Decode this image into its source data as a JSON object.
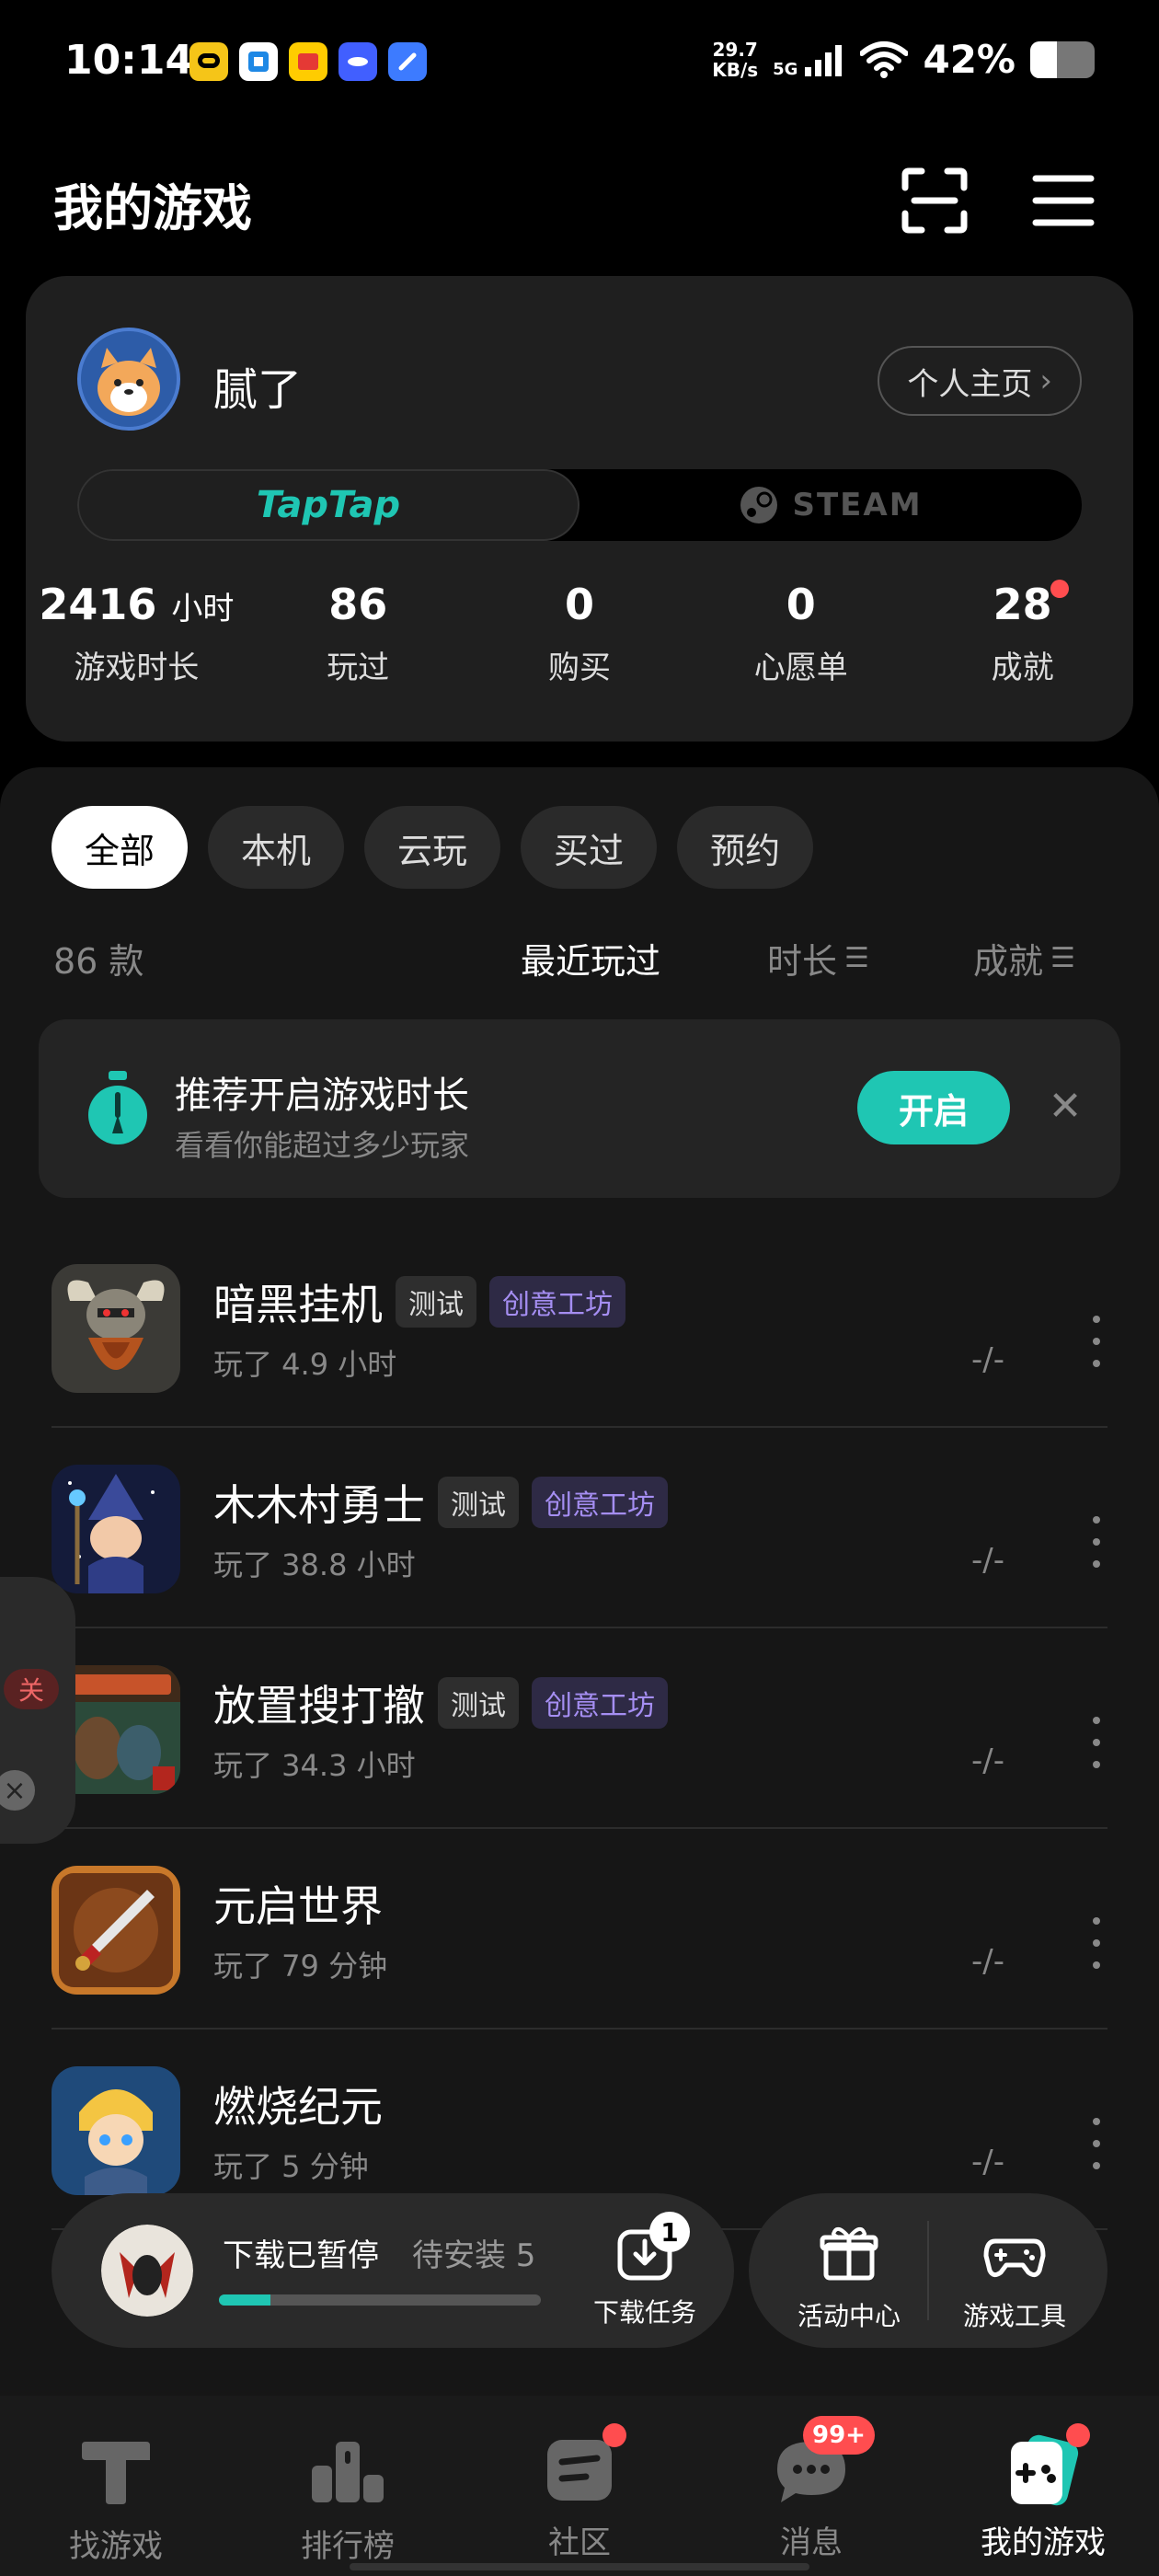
{
  "status_bar": {
    "time": "10:14",
    "speed_value": "29.7",
    "speed_unit": "KB/s",
    "network": "5G",
    "battery": "42%",
    "battery_level": 0.42
  },
  "header": {
    "title": "我的游戏",
    "scan_icon": "scan-icon",
    "menu_icon": "menu-icon"
  },
  "profile": {
    "username": "腻了",
    "homepage_label": "个人主页",
    "platforms": [
      "TapTap",
      "STEAM"
    ],
    "stats": [
      {
        "value": "2416",
        "unit": "小时",
        "label": "游戏时长"
      },
      {
        "value": "86",
        "unit": "",
        "label": "玩过"
      },
      {
        "value": "0",
        "unit": "",
        "label": "购买"
      },
      {
        "value": "0",
        "unit": "",
        "label": "心愿单"
      },
      {
        "value": "28",
        "unit": "",
        "label": "成就"
      }
    ]
  },
  "filters": [
    "全部",
    "本机",
    "云玩",
    "买过",
    "预约"
  ],
  "list_meta": {
    "count": "86 款",
    "sort_recent": "最近玩过",
    "sort_duration": "时长",
    "sort_achievement": "成就"
  },
  "recommend": {
    "title": "推荐开启游戏时长",
    "subtitle": "看看你能超过多少玩家",
    "button": "开启"
  },
  "games": [
    {
      "title": "暗黑挂机",
      "tags": [
        "测试",
        "创意工坊"
      ],
      "played": "玩了 4.9 小时",
      "achievement": "-/-"
    },
    {
      "title": "木木村勇士",
      "tags": [
        "测试",
        "创意工坊"
      ],
      "played": "玩了 38.8 小时",
      "achievement": "-/-"
    },
    {
      "title": "放置搜打撤",
      "tags": [
        "测试",
        "创意工坊"
      ],
      "played": "玩了 34.3 小时",
      "achievement": "-/-"
    },
    {
      "title": "元启世界",
      "tags": [],
      "played": "玩了 79 分钟",
      "achievement": "-/-"
    },
    {
      "title": "燃烧纪元",
      "tags": [],
      "played": "玩了 5 分钟",
      "achievement": "-/-"
    }
  ],
  "side_widget": {
    "label": "关"
  },
  "download": {
    "status": "下载已暂停",
    "pending": "待安装 5",
    "task_label": "下载任务",
    "task_badge": "1",
    "progress": 0.16
  },
  "tools": {
    "activity_label": "活动中心",
    "tools_label": "游戏工具"
  },
  "bottom_nav": [
    {
      "label": "找游戏",
      "icon": "taptap-logo-icon"
    },
    {
      "label": "排行榜",
      "icon": "leaderboard-icon"
    },
    {
      "label": "社区",
      "icon": "community-icon"
    },
    {
      "label": "消息",
      "icon": "message-icon",
      "badge": "99+"
    },
    {
      "label": "我的游戏",
      "icon": "gamepad-icon"
    }
  ],
  "colors": {
    "accent": "#1fc6b3",
    "badge_red": "#ff4d4f",
    "tag_purple": "#a58ef2"
  }
}
